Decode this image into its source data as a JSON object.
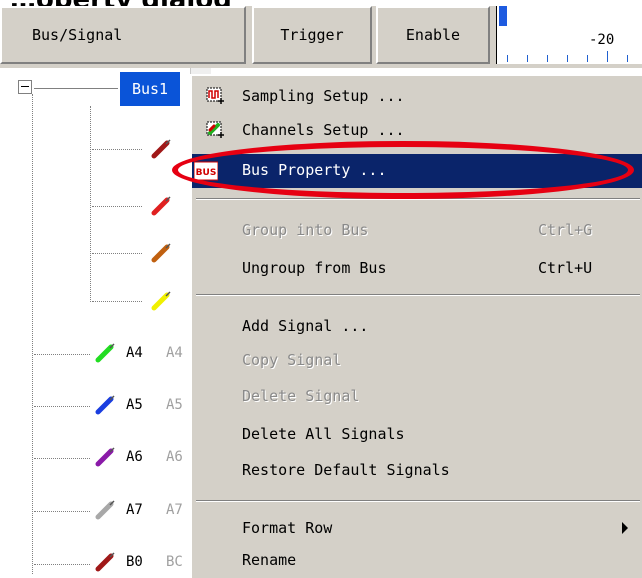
{
  "caption": "…operty dialog",
  "header": {
    "bus_signal": "Bus/Signal",
    "trigger": "Trigger",
    "enable": "Enable",
    "ruler_label": "-20"
  },
  "tree": {
    "bus_label": "Bus1",
    "signals": [
      {
        "name": "A4",
        "ghost": "A4",
        "color": "#22dd22"
      },
      {
        "name": "A5",
        "ghost": "A5",
        "color": "#1a3ee0"
      },
      {
        "name": "A6",
        "ghost": "A6",
        "color": "#8a1aa8"
      },
      {
        "name": "A7",
        "ghost": "A7",
        "color": "#a8a8a8"
      },
      {
        "name": "B0",
        "ghost": "BC",
        "color": "#a01818"
      }
    ],
    "bus_child_colors": [
      "#a01818",
      "#e02020",
      "#c06010",
      "#f0f000"
    ]
  },
  "menu": {
    "sampling_setup": "Sampling Setup ...",
    "channels_setup": "Channels Setup ...",
    "bus_property": "Bus Property ...",
    "bus_icon_text": "BUS",
    "group_into_bus": "Group into Bus",
    "group_into_bus_accel": "Ctrl+G",
    "ungroup_from_bus": "Ungroup from Bus",
    "ungroup_from_bus_accel": "Ctrl+U",
    "add_signal": "Add Signal ...",
    "copy_signal": "Copy Signal",
    "delete_signal": "Delete Signal",
    "delete_all_signals": "Delete All Signals",
    "restore_default_signals": "Restore Default Signals",
    "format_row": "Format Row",
    "rename": "Rename"
  },
  "colors": {
    "highlight": "#0a246a",
    "selection": "#0a54d8",
    "annotation_oval": "#e60012"
  }
}
